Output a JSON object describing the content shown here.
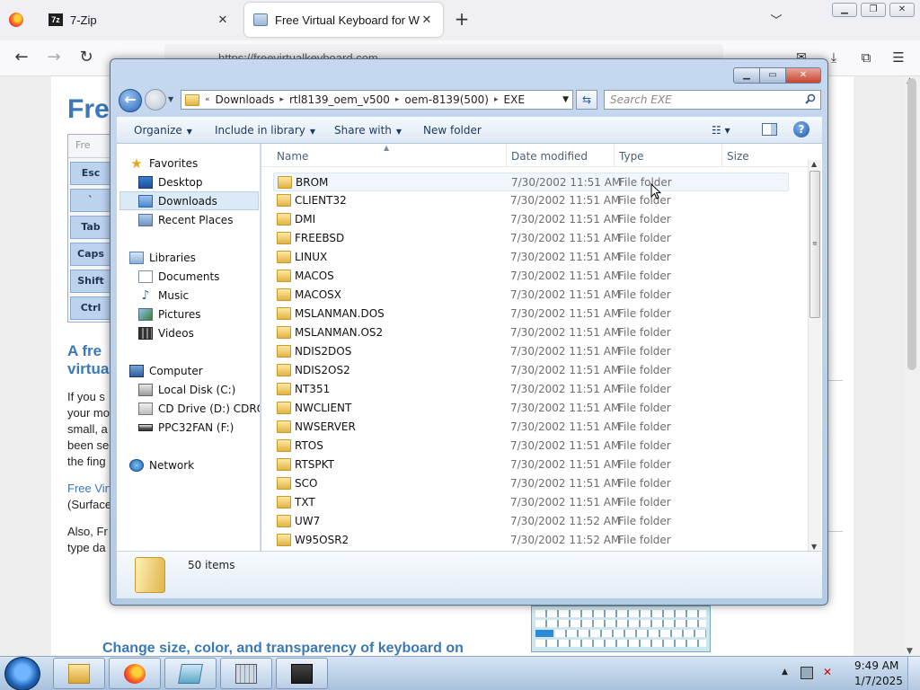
{
  "browser": {
    "tabs": [
      {
        "title": "7-Zip",
        "icon": "7zip-icon"
      },
      {
        "title": "Free Virtual Keyboard for Windows",
        "icon": "keyboard-icon",
        "active": true
      }
    ],
    "new_tab": "+",
    "close_glyph": "✕",
    "url": "https://freevirtualkeyboard.com",
    "nav": {
      "back": "←",
      "forward": "→",
      "reload": "↻",
      "menu": "☰"
    }
  },
  "web_page": {
    "title": "Free",
    "vk_header": "Fre",
    "vk_keys": [
      "Esc",
      "`",
      "Tab",
      "Caps",
      "Shift",
      "Ctrl"
    ],
    "subheading": "A fre virtua",
    "para1": "If you s your mo small, a been se the fing",
    "link": "Free Virt",
    "para2": "(Surface",
    "para3": "Also, Fr type da",
    "heading2": "Change size, color, and transparency of keyboard on"
  },
  "explorer": {
    "window_controls": {
      "minimize": "▁",
      "maximize": "▭",
      "close": "✕"
    },
    "breadcrumb": [
      "Downloads",
      "rtl8139_oem_v500",
      "oem-8139(500)",
      "EXE"
    ],
    "breadcrumb_prefix": "«",
    "search_placeholder": "Search EXE",
    "commands": {
      "organize": "Organize",
      "include_in_library": "Include in library",
      "share_with": "Share with",
      "new_folder": "New folder"
    },
    "nav_pane": {
      "favorites": "Favorites",
      "desktop": "Desktop",
      "downloads": "Downloads",
      "recent_places": "Recent Places",
      "libraries": "Libraries",
      "documents": "Documents",
      "music": "Music",
      "pictures": "Pictures",
      "videos": "Videos",
      "computer": "Computer",
      "local_disk": "Local Disk (C:)",
      "cd_drive": "CD Drive (D:) CDROM",
      "usb_drive": "PPC32FAN (F:)",
      "network": "Network"
    },
    "columns": {
      "name": "Name",
      "date_modified": "Date modified",
      "type": "Type",
      "size": "Size"
    },
    "files": [
      {
        "name": "BROM",
        "date": "7/30/2002 11:51 AM",
        "type": "File folder"
      },
      {
        "name": "CLIENT32",
        "date": "7/30/2002 11:51 AM",
        "type": "File folder"
      },
      {
        "name": "DMI",
        "date": "7/30/2002 11:51 AM",
        "type": "File folder"
      },
      {
        "name": "FREEBSD",
        "date": "7/30/2002 11:51 AM",
        "type": "File folder"
      },
      {
        "name": "LINUX",
        "date": "7/30/2002 11:51 AM",
        "type": "File folder"
      },
      {
        "name": "MACOS",
        "date": "7/30/2002 11:51 AM",
        "type": "File folder"
      },
      {
        "name": "MACOSX",
        "date": "7/30/2002 11:51 AM",
        "type": "File folder"
      },
      {
        "name": "MSLANMAN.DOS",
        "date": "7/30/2002 11:51 AM",
        "type": "File folder"
      },
      {
        "name": "MSLANMAN.OS2",
        "date": "7/30/2002 11:51 AM",
        "type": "File folder"
      },
      {
        "name": "NDIS2DOS",
        "date": "7/30/2002 11:51 AM",
        "type": "File folder"
      },
      {
        "name": "NDIS2OS2",
        "date": "7/30/2002 11:51 AM",
        "type": "File folder"
      },
      {
        "name": "NT351",
        "date": "7/30/2002 11:51 AM",
        "type": "File folder"
      },
      {
        "name": "NWCLIENT",
        "date": "7/30/2002 11:51 AM",
        "type": "File folder"
      },
      {
        "name": "NWSERVER",
        "date": "7/30/2002 11:51 AM",
        "type": "File folder"
      },
      {
        "name": "RTOS",
        "date": "7/30/2002 11:51 AM",
        "type": "File folder"
      },
      {
        "name": "RTSPKT",
        "date": "7/30/2002 11:51 AM",
        "type": "File folder"
      },
      {
        "name": "SCO",
        "date": "7/30/2002 11:51 AM",
        "type": "File folder"
      },
      {
        "name": "TXT",
        "date": "7/30/2002 11:51 AM",
        "type": "File folder"
      },
      {
        "name": "UW7",
        "date": "7/30/2002 11:52 AM",
        "type": "File folder"
      },
      {
        "name": "W95OSR2",
        "date": "7/30/2002 11:52 AM",
        "type": "File folder"
      }
    ],
    "item_count": "50 items"
  },
  "taskbar": {
    "apps": [
      "windows-explorer",
      "firefox",
      "virtual-keyboard",
      "calculator",
      "network-app"
    ],
    "clock_time": "9:49 AM",
    "clock_date": "1/7/2025"
  },
  "colors": {
    "accent": "#3b78b7",
    "explorer_frame": "#c5d8ef",
    "selection": "#dce9f7"
  }
}
